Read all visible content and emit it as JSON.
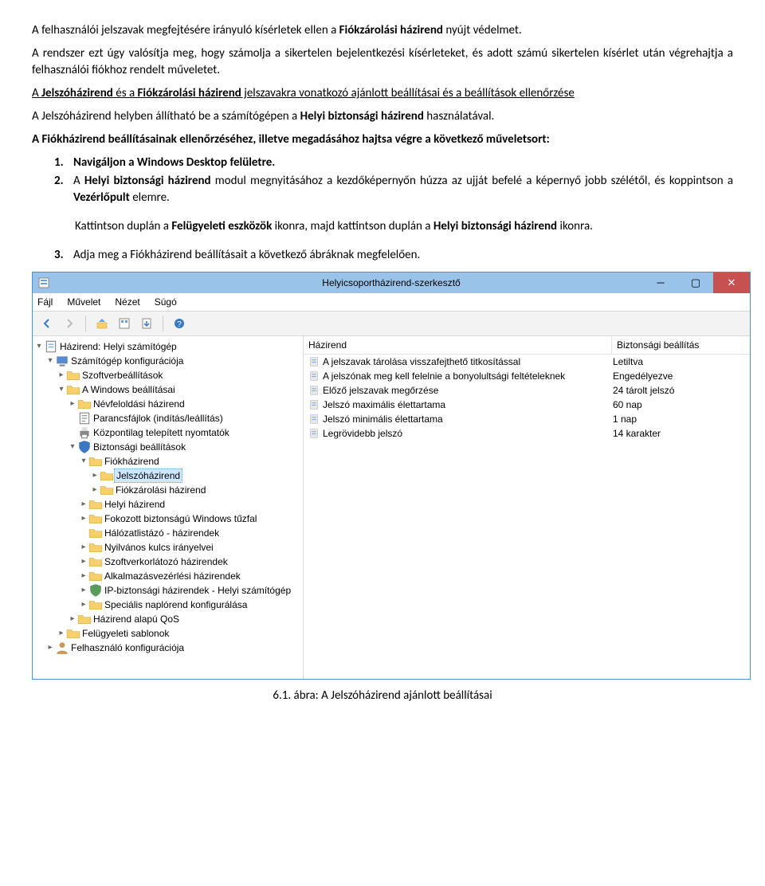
{
  "doc": {
    "p1": {
      "a": "A felhasználói jelszavak megfejtésére irányuló kísérletek ellen a ",
      "b": "Fiókzárolási házirend",
      "c": " nyújt védelmet."
    },
    "p2": "A rendszer ezt úgy valósítja meg, hogy számolja a sikertelen bejelentkezési kísérleteket, és adott számú sikertelen kísérlet után végrehajtja a felhasználói fiókhoz rendelt műveletet.",
    "p3": {
      "a": "A ",
      "b": "Jelszóházirend",
      "c": " és a ",
      "d": "Fiókzárolási házirend",
      "e": " jelszavakra vonatkozó ajánlott beállításai és a beállítások ellenőrzése"
    },
    "p4": {
      "a": "A Jelszóházirend helyben állítható be a számítógépen a ",
      "b": "Helyi biztonsági házirend",
      "c": " használatával."
    },
    "p5": "A Fiókházirend beállításainak ellenőrzéséhez, illetve megadásához hajtsa végre a következő műveletsort:",
    "steps": {
      "s1": {
        "num": "1.",
        "text": "Navigáljon a Windows Desktop felületre."
      },
      "s2": {
        "num": "2.",
        "a": "A ",
        "b": "Helyi biztonsági házirend",
        "c": " modul megnyitásához a kezdőképernyőn húzza az ujját befelé a képernyő jobb szélétől, és koppintson a ",
        "d": "Vezérlőpult",
        "e": " elemre."
      },
      "s2b": {
        "a": "Kattintson duplán a ",
        "b": "Felügyeleti eszközök",
        "c": " ikonra, majd kattintson duplán a ",
        "d": "Helyi biztonsági házirend",
        "e": " ikonra."
      },
      "s3": {
        "num": "3.",
        "text": "Adja meg a Fiókházirend beállításait a következő ábráknak megfelelően."
      }
    },
    "caption": "6.1. ábra: A Jelszóházirend ajánlott beállításai"
  },
  "win": {
    "title": "Helyicsoportházirend-szerkesztő",
    "menu": {
      "file": "Fájl",
      "action": "Művelet",
      "view": "Nézet",
      "help": "Súgó"
    },
    "list_header": {
      "col1": "Házirend",
      "col2": "Biztonsági beállítás"
    },
    "policies": [
      {
        "name": "A jelszavak tárolása visszafejthető titkosítással",
        "value": "Letiltva"
      },
      {
        "name": "A jelszónak meg kell felelnie a bonyolultsági feltételeknek",
        "value": "Engedélyezve"
      },
      {
        "name": "Előző jelszavak megőrzése",
        "value": "24 tárolt jelszó"
      },
      {
        "name": "Jelszó maximális élettartama",
        "value": "60 nap"
      },
      {
        "name": "Jelszó minimális élettartama",
        "value": "1 nap"
      },
      {
        "name": "Legrövidebb jelszó",
        "value": "14 karakter"
      }
    ],
    "tree": {
      "root": "Házirend: Helyi számítógép",
      "n1": "Számítógép konfigurációja",
      "n2": "Szoftverbeállítások",
      "n3": "A Windows beállításai",
      "n4": "Névfeloldási házirend",
      "n5": "Parancsfájlok (indítás/leállítás)",
      "n6": "Központilag telepített nyomtatók",
      "n7": "Biztonsági beállítások",
      "n8": "Fiókházirend",
      "n9": "Jelszóházirend",
      "n10": "Fiókzárolási házirend",
      "n11": "Helyi házirend",
      "n12": "Fokozott biztonságú Windows tűzfal",
      "n13": "Hálózatlistázó - házirendek",
      "n14": "Nyilvános kulcs irányelvei",
      "n15": "Szoftverkorlátozó házirendek",
      "n16": "Alkalmazásvezérlési házirendek",
      "n17": "IP-biztonsági házirendek - Helyi számítógép",
      "n18": "Speciális naplórend konfigurálása",
      "n19": "Házirend alapú QoS",
      "n20": "Felügyeleti sablonok",
      "n21": "Felhasználó konfigurációja"
    }
  }
}
